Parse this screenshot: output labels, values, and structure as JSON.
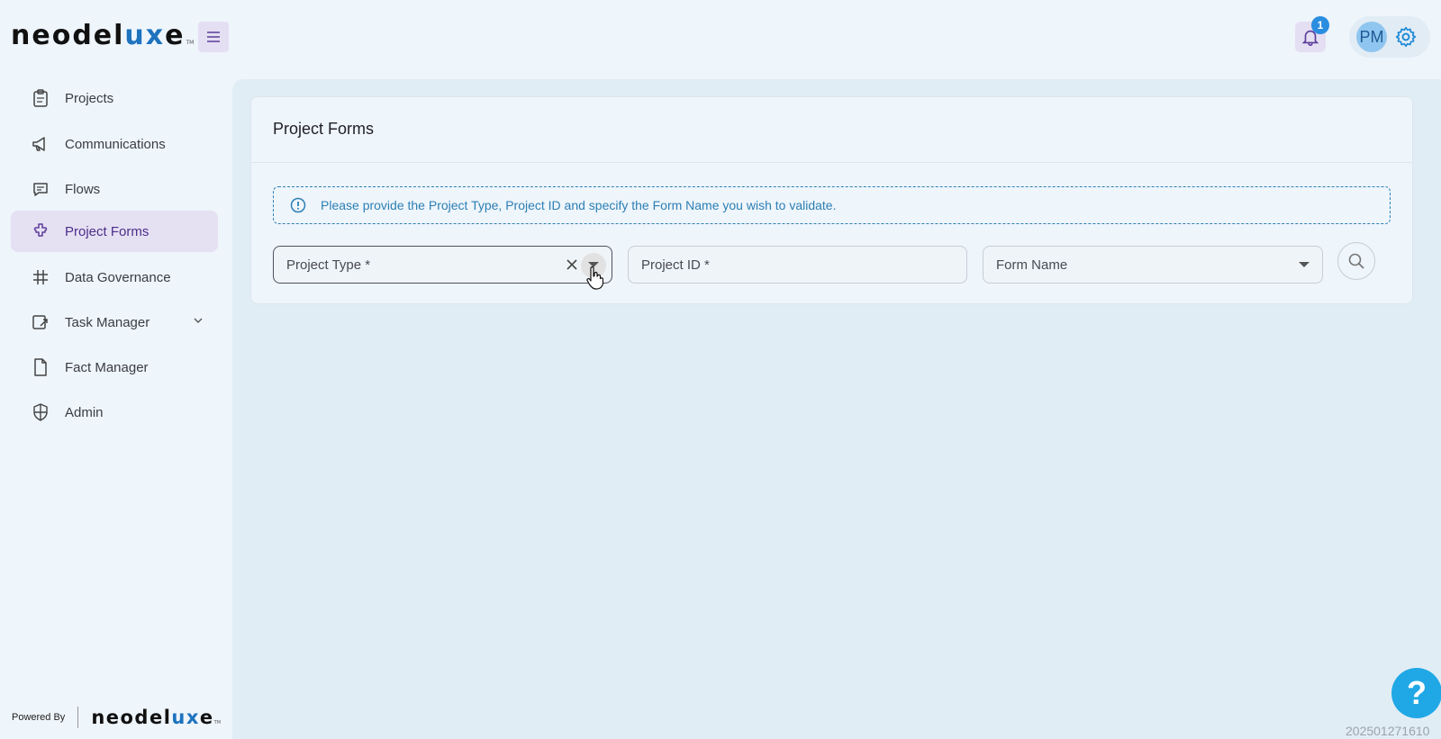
{
  "brand": {
    "name_a": "neodel",
    "name_b": "ux",
    "name_c": "e",
    "tm": "TM"
  },
  "header": {
    "notification_count": "1",
    "avatar_initials": "PM"
  },
  "sidebar": {
    "items": [
      {
        "label": "Projects",
        "icon": "clipboard-icon"
      },
      {
        "label": "Communications",
        "icon": "megaphone-icon"
      },
      {
        "label": "Flows",
        "icon": "chat-icon"
      },
      {
        "label": "Project Forms",
        "icon": "puzzle-icon",
        "active": true
      },
      {
        "label": "Data Governance",
        "icon": "grid-icon"
      },
      {
        "label": "Task Manager",
        "icon": "task-icon",
        "expandable": true
      },
      {
        "label": "Fact Manager",
        "icon": "file-icon"
      },
      {
        "label": "Admin",
        "icon": "shield-icon"
      }
    ],
    "powered_by": "Powered By"
  },
  "main": {
    "title": "Project Forms",
    "alert": "Please provide the Project Type, Project ID and specify the Form Name you wish to validate.",
    "fields": {
      "project_type": "Project Type *",
      "project_id": "Project ID *",
      "form_name": "Form Name"
    }
  },
  "footer": {
    "build": "202501271610",
    "help": "?"
  },
  "colors": {
    "accent": "#4b2f8a",
    "brand_blue": "#1e73be",
    "info": "#2d7fb4",
    "help": "#20a8e6"
  }
}
